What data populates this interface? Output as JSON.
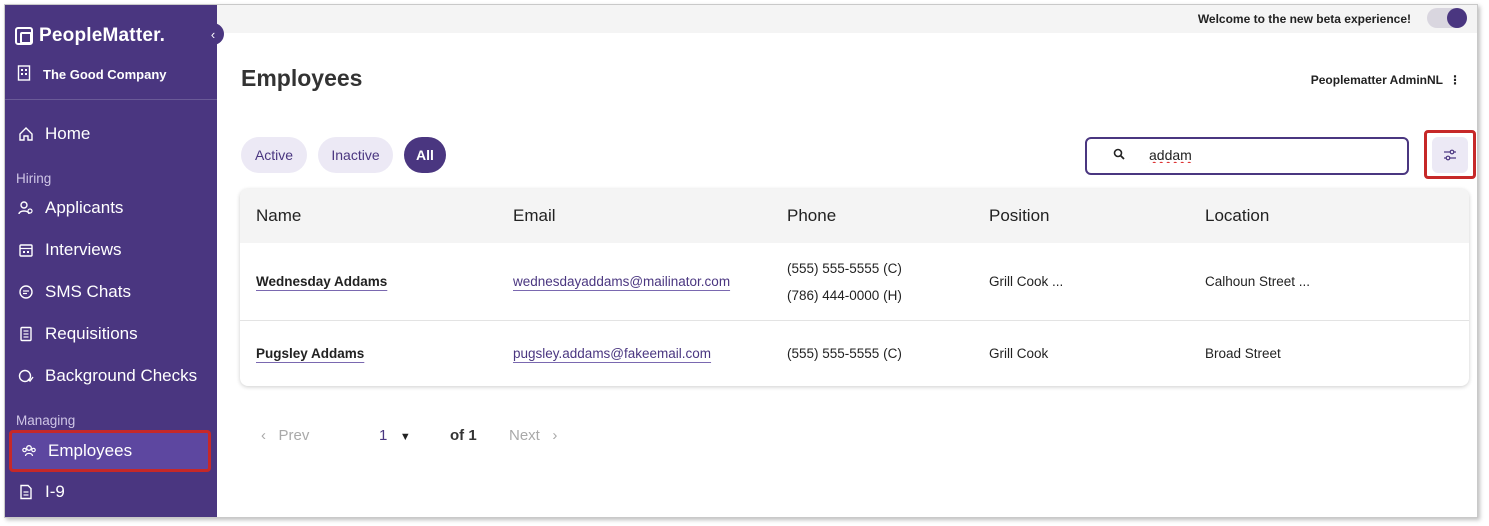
{
  "brand": {
    "name": "PeopleMatter."
  },
  "company": {
    "name": "The Good Company"
  },
  "nav": {
    "home": "Home",
    "hiring_section": "Hiring",
    "applicants": "Applicants",
    "interviews": "Interviews",
    "sms_chats": "SMS Chats",
    "requisitions": "Requisitions",
    "background_checks": "Background Checks",
    "managing_section": "Managing",
    "employees": "Employees",
    "i9": "I-9"
  },
  "topbar": {
    "beta_message": "Welcome to the new beta experience!",
    "beta_toggle_on": true
  },
  "page": {
    "title": "Employees",
    "user": "Peoplematter AdminNL"
  },
  "filters": {
    "active": "Active",
    "inactive": "Inactive",
    "all": "All",
    "selected": "All"
  },
  "search": {
    "value": "addam"
  },
  "table": {
    "headers": {
      "name": "Name",
      "email": "Email",
      "phone": "Phone",
      "position": "Position",
      "location": "Location"
    },
    "rows": [
      {
        "name": "Wednesday Addams",
        "email": "wednesdayaddams@mailinator.com",
        "phone1": "(555) 555-5555 (C)",
        "phone2": "(786) 444-0000 (H)",
        "position": "Grill Cook ...",
        "location": "Calhoun Street ..."
      },
      {
        "name": "Pugsley Addams",
        "email": "pugsley.addams@fakeemail.com",
        "phone1": "(555) 555-5555 (C)",
        "position": "Grill Cook",
        "location": "Broad Street"
      }
    ]
  },
  "pagination": {
    "prev": "Prev",
    "page": "1",
    "of": "of 1",
    "next": "Next"
  },
  "colors": {
    "primary": "#4a3680",
    "highlight": "#c62828",
    "chip_bg": "#ece9f5"
  }
}
